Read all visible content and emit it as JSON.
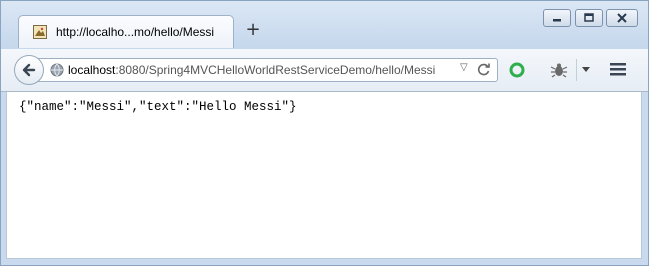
{
  "browser": {
    "tab": {
      "title": "http://localho...mo/hello/Messi",
      "new_tab_label": "+"
    },
    "window_controls": [
      "minimize",
      "maximize",
      "close"
    ],
    "address_bar": {
      "host": "localhost",
      "rest": ":8080/Spring4MVCHelloWorldRestServiceDemo/hello/Messi"
    },
    "icons": {
      "back": "back-arrow-icon",
      "site": "globe-icon",
      "dropdown": "dropdown-arrow-icon",
      "reload": "reload-icon",
      "extension_green": "green-circle-extension-icon",
      "extension_bug": "bug-extension-icon",
      "extension_menu": "chevron-down-icon",
      "menu": "hamburger-menu-icon"
    }
  },
  "page": {
    "body_text": "{\"name\":\"Messi\",\"text\":\"Hello Messi\"}"
  }
}
